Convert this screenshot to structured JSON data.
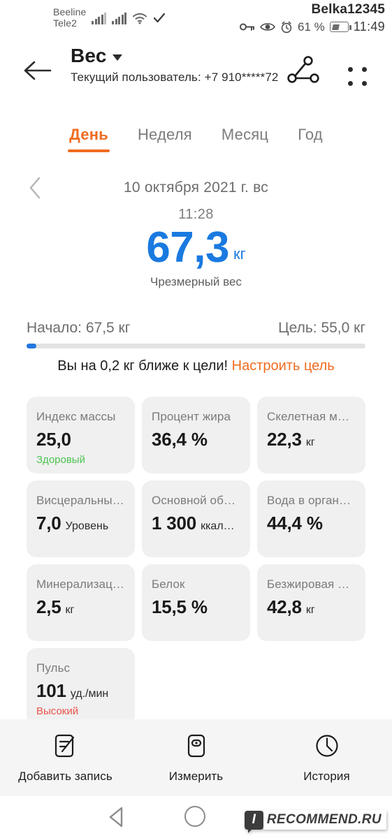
{
  "statusbar": {
    "carrier1": "Beeline",
    "carrier2": "Tele2",
    "account_name": "Belka12345",
    "battery_percent": "61 %",
    "clock": "11:49",
    "icons": [
      "signal-icon",
      "signal-icon",
      "wifi-icon",
      "check-icon",
      "key-icon",
      "eye-icon",
      "alarm-clock-icon",
      "battery-icon"
    ]
  },
  "appbar": {
    "back_label": "back-arrow-icon",
    "title": "Вес",
    "subtitle": "Текущий пользователь: +7 910*****72",
    "share_label": "share-icon",
    "more_label": "more-options-icon"
  },
  "tabs": [
    {
      "label": "День",
      "active": true
    },
    {
      "label": "Неделя",
      "active": false
    },
    {
      "label": "Месяц",
      "active": false
    },
    {
      "label": "Год",
      "active": false
    }
  ],
  "date": {
    "prev_label": "chevron-left-icon",
    "text": "10 октября 2021 г. вс"
  },
  "hero": {
    "time": "11:28",
    "weight": "67,3",
    "unit": "кг",
    "status": "Чрезмерный вес",
    "color": "#1a7ae0"
  },
  "goal": {
    "start_label": "Начало: 67,5 кг",
    "target_label": "Цель: 55,0 кг",
    "progress_percent": 2.8,
    "message": "Вы на 0,2 кг ближе к цели!",
    "cta": "Настроить цель",
    "cta_color": "#ef6c20",
    "fill_color": "#2277dd"
  },
  "metrics": [
    {
      "label": "Индекс массы",
      "value": "25,0",
      "unit": "",
      "note": "Здоровый",
      "note_kind": "good"
    },
    {
      "label": "Процент жира",
      "value": "36,4 %",
      "unit": "",
      "note": "",
      "note_kind": ""
    },
    {
      "label": "Скелетная м…",
      "value": "22,3",
      "unit": "кг",
      "note": "",
      "note_kind": ""
    },
    {
      "label": "Висцеральны…",
      "value": "7,0",
      "unit": "Уровень",
      "note": "",
      "note_kind": ""
    },
    {
      "label": "Основной об…",
      "value": "1 300",
      "unit": "ккал…",
      "note": "",
      "note_kind": ""
    },
    {
      "label": "Вода в орган…",
      "value": "44,4 %",
      "unit": "",
      "note": "",
      "note_kind": ""
    },
    {
      "label": "Минерализац…",
      "value": "2,5",
      "unit": "кг",
      "note": "",
      "note_kind": ""
    },
    {
      "label": "Белок",
      "value": "15,5 %",
      "unit": "",
      "note": "",
      "note_kind": ""
    },
    {
      "label": "Безжировая …",
      "value": "42,8",
      "unit": "кг",
      "note": "",
      "note_kind": ""
    },
    {
      "label": "Пульс",
      "value": "101",
      "unit": "уд./мин",
      "note": "Высокий",
      "note_kind": "bad"
    }
  ],
  "bottomnav": [
    {
      "label": "Добавить запись",
      "icon": "add-record-icon"
    },
    {
      "label": "Измерить",
      "icon": "scale-icon"
    },
    {
      "label": "История",
      "icon": "clock-icon"
    }
  ],
  "sysnav": {
    "back": "system-back-icon",
    "home": "system-home-icon"
  },
  "watermark": {
    "badge": "I",
    "text": "RECOMMEND.RU"
  }
}
